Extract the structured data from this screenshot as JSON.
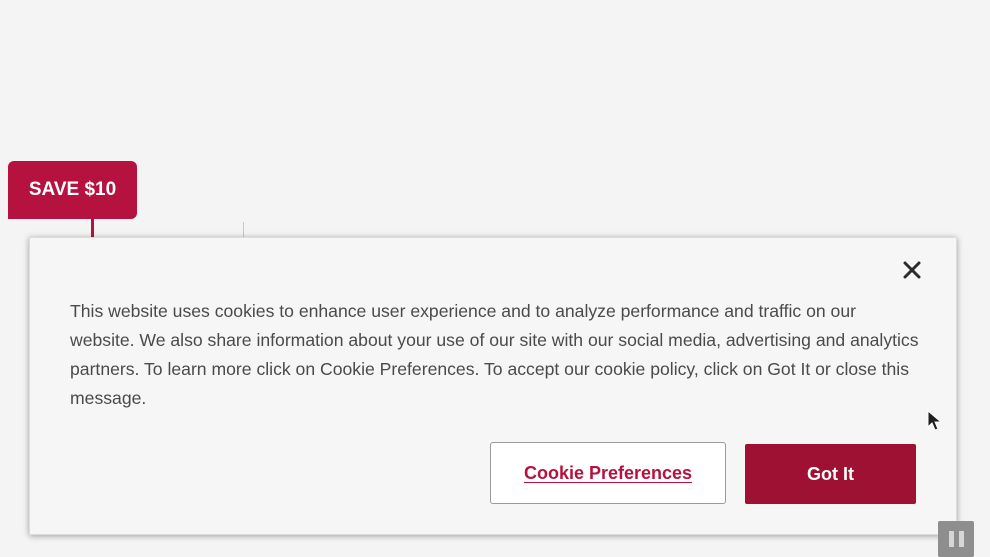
{
  "promo": {
    "badge_label": "SAVE $10",
    "badge_color": "#b5123f"
  },
  "cookie_banner": {
    "close_icon": "close-icon",
    "message": "This website uses cookies to enhance user experience and to analyze performance and traffic on our website. We also share information about your use of our site with our social media, advertising and analytics partners. To learn more click on Cookie Preferences. To accept our cookie policy, click on Got It or close this message.",
    "preferences_label": "Cookie Preferences",
    "accept_label": "Got It",
    "accent_color": "#9e1132"
  },
  "media_controls": {
    "pause_icon": "pause-icon"
  },
  "cursor_icon": "mouse-pointer-icon"
}
